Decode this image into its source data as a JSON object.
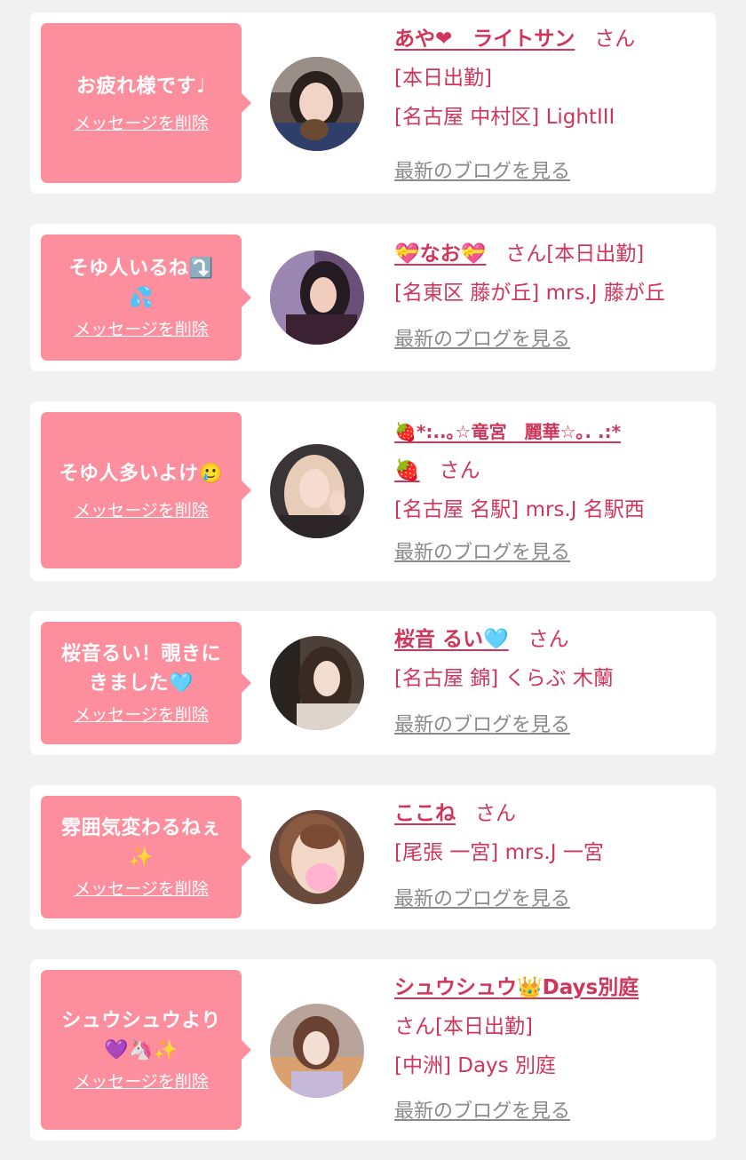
{
  "cards": [
    {
      "message_lines": [
        "お疲れ様です♩"
      ],
      "delete_label": "メッセージを削除",
      "name": "あや❤︎　ライトサン",
      "san": "さん",
      "detail_lines": [
        "[本日出勤]",
        "[名古屋 中村区] LightIII"
      ],
      "blog_label": "最新のブログを見る"
    },
    {
      "message_lines": [
        "そゆ人いるね⤵️",
        "💦"
      ],
      "delete_label": "メッセージを削除",
      "name": "💝なお💝",
      "san": "さん[本日出勤]",
      "detail_lines": [
        "[名東区 藤が丘] mrs.J 藤が丘"
      ],
      "blog_label": "最新のブログを見る"
    },
    {
      "message_lines": [
        "そゆ人多いよけ🥲"
      ],
      "delete_label": "メッセージを削除",
      "name": "🍓*:..｡☆竜宮　麗華☆｡. .:*",
      "name_cont": "🍓",
      "san": "さん",
      "detail_lines": [
        "[名古屋 名駅] mrs.J 名駅西"
      ],
      "blog_label": "最新のブログを見る"
    },
    {
      "message_lines": [
        "桜音るい！覗きに",
        "きました🩵"
      ],
      "delete_label": "メッセージを削除",
      "name": "桜音 るい🩵",
      "san": "さん",
      "detail_lines": [
        "[名古屋 錦] くらぶ 木蘭"
      ],
      "blog_label": "最新のブログを見る"
    },
    {
      "message_lines": [
        "雰囲気変わるねぇ",
        "✨"
      ],
      "delete_label": "メッセージを削除",
      "name": "ここね",
      "san": "さん",
      "detail_lines": [
        "[尾張 一宮] mrs.J 一宮"
      ],
      "blog_label": "最新のブログを見る"
    },
    {
      "message_lines": [
        "シュウシュウより",
        "💜🦄✨"
      ],
      "delete_label": "メッセージを削除",
      "name": "シュウシュウ👑Days別庭",
      "san": "さん[本日出勤]",
      "detail_lines": [
        "[中洲] Days 別庭"
      ],
      "blog_label": "最新のブログを見る"
    }
  ],
  "colors": {
    "page_background": "#f1f1f2",
    "card_background": "#ffffff",
    "bubble": "#fd8e9d",
    "accent_text": "#d0365b",
    "link_gray": "#8a8a8a"
  }
}
